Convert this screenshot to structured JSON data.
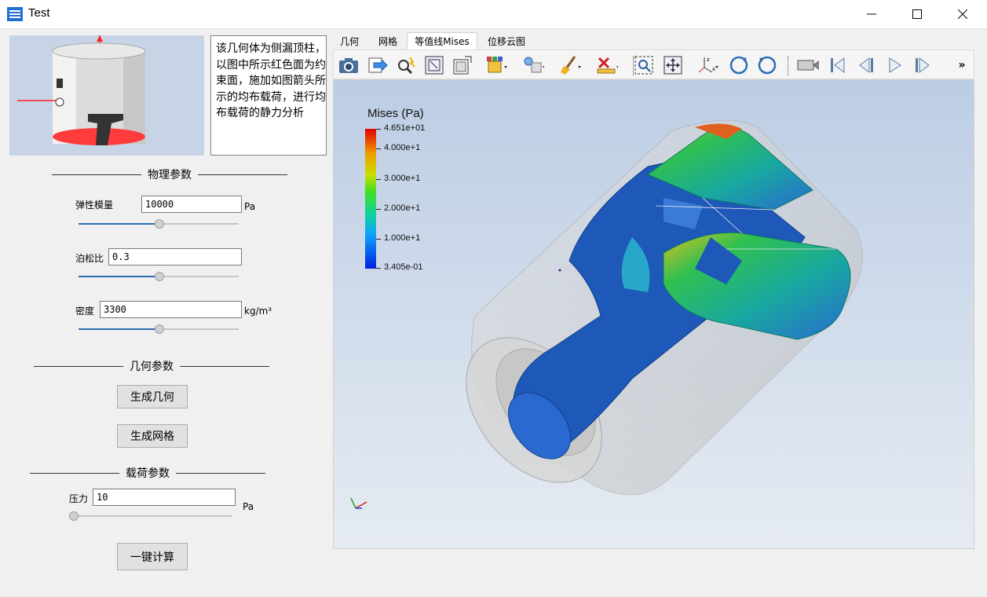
{
  "window": {
    "title": "Test"
  },
  "description": {
    "text": "该几何体为侧漏顶柱，以图中所示红色面为约束面，施加如图箭头所示的均布载荷，进行均布载荷的静力分析"
  },
  "physics": {
    "heading": "物理参数",
    "modulus_label": "弹性模量",
    "modulus_value": "10000",
    "modulus_unit": "Pa",
    "modulus_slider": 0.5,
    "poisson_label": "泊松比",
    "poisson_value": "0.3",
    "poisson_slider": 0.5,
    "density_label": "密度",
    "density_value": "3300",
    "density_unit": "kg/m³",
    "density_slider": 0.5
  },
  "geometry": {
    "heading": "几何参数",
    "gen_geometry": "生成几何",
    "gen_mesh": "生成网格"
  },
  "load": {
    "heading": "载荷参数",
    "pressure_label": "压力",
    "pressure_value": "10",
    "pressure_unit": "Pa",
    "pressure_slider": 0.0
  },
  "compute_button": "一键计算",
  "tabs": [
    "几何",
    "网格",
    "等值线Mises",
    "位移云图"
  ],
  "active_tab": 2,
  "legend": {
    "title": "Mises (Pa)",
    "ticks": [
      "4.651e+01",
      "4.000e+1",
      "3.000e+1",
      "2.000e+1",
      "1.000e+1",
      "3.405e-01"
    ]
  },
  "toolbar": {
    "icons": [
      "camera-icon",
      "export-icon",
      "query-icon",
      "zoom-fit-icon",
      "box-zoom-icon",
      "box-select-icon",
      "light-icon",
      "brush-icon",
      "delete-icon",
      "zoom-region-icon",
      "pan-icon",
      "axes-icon",
      "rotate-cw-icon",
      "rotate-ccw-icon",
      "record-icon",
      "first-frame-icon",
      "prev-frame-icon",
      "play-icon",
      "last-frame-icon"
    ],
    "overflow": "»"
  },
  "colors": {
    "accent": "#2a6db5",
    "constraint_face": "#ff3b3b"
  }
}
